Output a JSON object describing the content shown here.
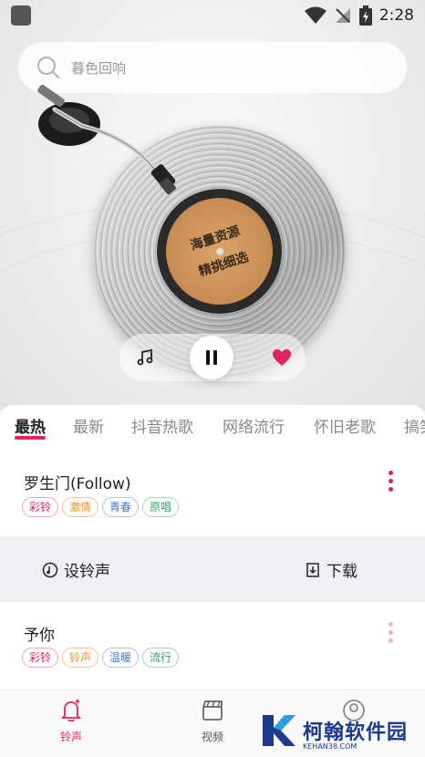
{
  "status_bar": {
    "time": "2:28"
  },
  "search": {
    "placeholder": "暮色回响"
  },
  "record": {
    "label_line1": "海量资源",
    "label_line2": "精挑细选"
  },
  "player": {
    "state": "playing"
  },
  "tabs": [
    {
      "label": "最热",
      "active": true
    },
    {
      "label": "最新"
    },
    {
      "label": "抖音热歌"
    },
    {
      "label": "网络流行"
    },
    {
      "label": "怀旧老歌"
    },
    {
      "label": "搞笑"
    }
  ],
  "songs": [
    {
      "title": "罗生门(Follow)",
      "tags": [
        "彩铃",
        "激情",
        "青春",
        "原唱"
      ]
    },
    {
      "title": "予你",
      "tags": [
        "彩铃",
        "铃声",
        "温暖",
        "流行"
      ]
    }
  ],
  "actions": {
    "set_ringtone": "设铃声",
    "download": "下载"
  },
  "bottom_nav": [
    {
      "label": "铃声",
      "active": true
    },
    {
      "label": "视频"
    },
    {
      "label": ""
    }
  ],
  "watermark": {
    "name": "柯翰软件园",
    "sub": "KEHAN38.COM"
  },
  "colors": {
    "accent": "#e0245e",
    "tag_pink": "#e0245e",
    "tag_orange": "#f0912e",
    "tag_blue": "#3e7bd6",
    "tag_green": "#2aa36b"
  }
}
